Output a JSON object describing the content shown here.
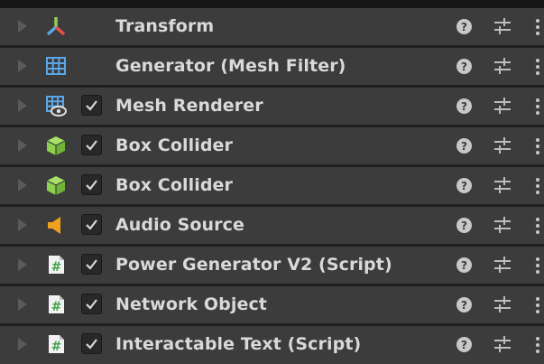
{
  "components": [
    {
      "label": "Transform",
      "icon": "transform-axes-icon",
      "has_checkbox": false,
      "checked": false
    },
    {
      "label": "Generator (Mesh Filter)",
      "icon": "mesh-filter-grid-icon",
      "has_checkbox": false,
      "checked": false
    },
    {
      "label": "Mesh Renderer",
      "icon": "mesh-renderer-icon",
      "has_checkbox": true,
      "checked": true
    },
    {
      "label": "Box Collider",
      "icon": "box-collider-icon",
      "has_checkbox": true,
      "checked": true
    },
    {
      "label": "Box Collider",
      "icon": "box-collider-icon",
      "has_checkbox": true,
      "checked": true
    },
    {
      "label": "Audio Source",
      "icon": "audio-source-speaker-icon",
      "has_checkbox": true,
      "checked": true
    },
    {
      "label": "Power Generator V2 (Script)",
      "icon": "script-hash-icon",
      "has_checkbox": true,
      "checked": true
    },
    {
      "label": "Network Object",
      "icon": "script-hash-icon",
      "has_checkbox": true,
      "checked": true
    },
    {
      "label": "Interactable Text (Script)",
      "icon": "script-hash-icon",
      "has_checkbox": true,
      "checked": true
    }
  ],
  "colors": {
    "row_bg": "#3c3c3c",
    "label_text": "#d9d9d9",
    "box_collider_green": "#8fd14f",
    "audio_orange": "#f0a020",
    "mesh_blue": "#5aa7e8"
  }
}
